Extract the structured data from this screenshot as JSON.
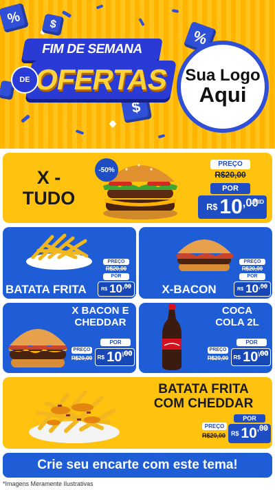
{
  "header": {
    "title_line1": "FIM DE SEMANA",
    "title_de": "DE",
    "title_line2": "OFERTAS",
    "logo_line1": "Sua Logo",
    "logo_line2": "Aqui"
  },
  "colors": {
    "brand_blue": "#1f5dd6",
    "brand_yellow": "#ffc20e"
  },
  "products": [
    {
      "name": "X - TUDO",
      "badge": "-50%",
      "price_label": "PREÇO",
      "old_price": "R$20,00",
      "por_label": "POR",
      "currency": "R$",
      "price_int": "10",
      "price_dec": ",00",
      "unit": "UNID",
      "image": "burger-icon"
    },
    {
      "name": "BATATA FRITA",
      "price_label": "PREÇO",
      "old_price": "R$20,00",
      "por_label": "POR",
      "currency": "R$",
      "price_int": "10",
      "price_dec": ",00",
      "unit": "POÇ",
      "image": "fries-icon"
    },
    {
      "name": "X-BACON",
      "price_label": "PREÇO",
      "old_price": "R$20,00",
      "por_label": "POR",
      "currency": "R$",
      "price_int": "10",
      "price_dec": ",00",
      "unit": "POÇ",
      "image": "bacon-burger-icon"
    },
    {
      "name": "X BACON E CHEDDAR",
      "price_label": "PREÇO",
      "old_price": "R$20,00",
      "por_label": "POR",
      "currency": "R$",
      "price_int": "10",
      "price_dec": ",00",
      "unit": "UNID",
      "image": "cheddar-burger-icon"
    },
    {
      "name": "COCA COLA 2L",
      "price_label": "PREÇO",
      "old_price": "R$20,00",
      "por_label": "POR",
      "currency": "R$",
      "price_int": "10",
      "price_dec": ",00",
      "unit": "UNID",
      "image": "soda-bottle-icon"
    },
    {
      "name": "BATATA FRITA COM CHEDDAR",
      "price_label": "PREÇO",
      "old_price": "R$20,00",
      "por_label": "POR",
      "currency": "R$",
      "price_int": "10",
      "price_dec": ",00",
      "unit": "POÇ",
      "image": "cheddar-fries-icon"
    }
  ],
  "cta": "Crie seu encarte com este tema!",
  "disclaimer": "*Imagens Meramente Ilustrativas"
}
